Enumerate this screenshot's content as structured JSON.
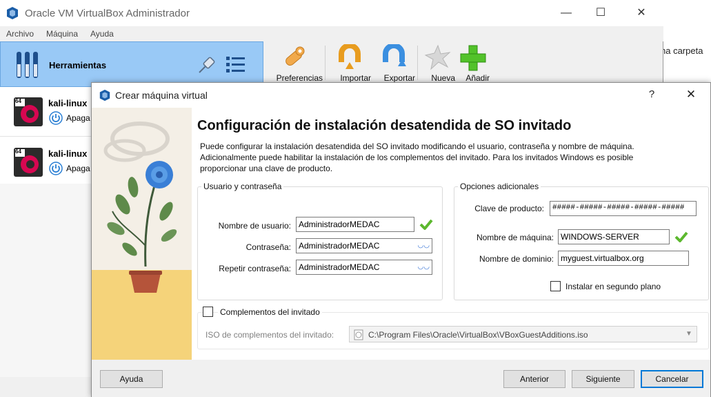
{
  "main_window": {
    "title": "Oracle VM VirtualBox Administrador",
    "controls": {
      "minimize": "—",
      "maximize": "☐",
      "close": "✕"
    },
    "menu": [
      "Archivo",
      "Máquina",
      "Ayuda"
    ],
    "sidebar": {
      "tools_label": "Herramientas",
      "vms": [
        {
          "name": "kali-linux",
          "state": "Apaga",
          "os_badge": "64"
        },
        {
          "name": "kali-linux",
          "state": "Apaga",
          "os_badge": "64"
        }
      ]
    },
    "toolbar": [
      {
        "label": "Preferencias",
        "icon": "preferences-icon"
      },
      {
        "label": "Importar",
        "icon": "import-icon"
      },
      {
        "label": "Exportar",
        "icon": "export-icon"
      },
      {
        "label": "Nueva",
        "icon": "new-icon"
      },
      {
        "label": "Añadir",
        "icon": "add-icon"
      }
    ]
  },
  "background_text": "ha carpeta",
  "dialog": {
    "title": "Crear máquina virtual",
    "help": "?",
    "close": "✕",
    "heading": "Configuración de instalación desatendida de SO invitado",
    "description": "Puede configurar la instalación desatendida del SO invitado modificando el usuario, contraseña y nombre de máquina. Adicionalmente puede habilitar la instalación de los complementos del invitado. Para los invitados Windows es posible proporcionar una clave de producto.",
    "user_group": {
      "title": "Usuario y contraseña",
      "username_label": "Nombre de usuario:",
      "username_value": "AdministradorMEDAC",
      "password_label": "Contraseña:",
      "password_value": "AdministradorMEDAC",
      "repeat_label": "Repetir contraseña:",
      "repeat_value": "AdministradorMEDAC"
    },
    "options_group": {
      "title": "Opciones adicionales",
      "product_key_label": "Clave de producto:",
      "product_key_value": "#####-#####-#####-#####-#####",
      "hostname_label": "Nombre de máquina:",
      "hostname_value": "WINDOWS-SERVER",
      "domain_label": "Nombre de dominio:",
      "domain_value": "myguest.virtualbox.org",
      "background_install_label": "Instalar en segundo plano",
      "background_install_checked": false
    },
    "guest_additions": {
      "label": "Complementos del invitado",
      "checked": false,
      "iso_label": "ISO de complementos del invitado:",
      "iso_path": "C:\\Program Files\\Oracle\\VirtualBox\\VBoxGuestAdditions.iso"
    },
    "buttons": {
      "help": "Ayuda",
      "back": "Anterior",
      "next": "Siguiente",
      "cancel": "Cancelar"
    },
    "colors": {
      "accent": "#0078d7",
      "ok_green": "#5cb82e",
      "selection": "#99c9f6"
    }
  }
}
